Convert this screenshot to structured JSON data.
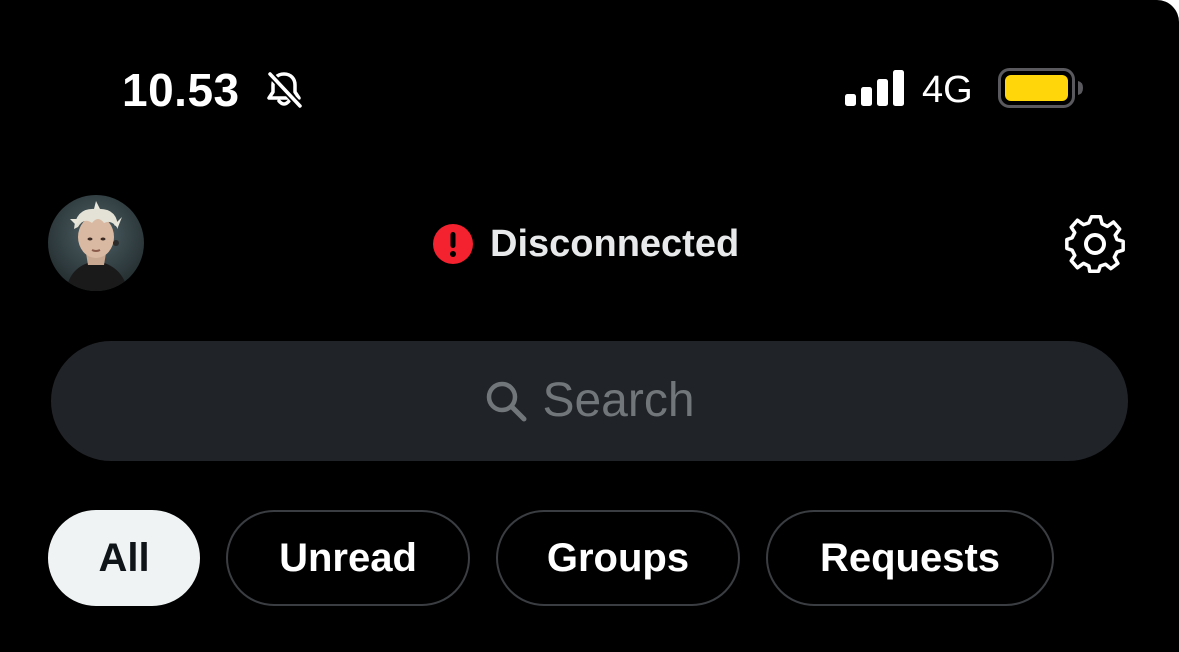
{
  "status_bar": {
    "time": "10.53",
    "silent_icon": "bell-slash-icon",
    "signal_icon": "cellular-signal-icon",
    "network": "4G",
    "battery_icon": "battery-icon",
    "battery_color": "#ffd60a"
  },
  "header": {
    "avatar": "profile-avatar",
    "connection_status": "Disconnected",
    "connection_icon": "alert-icon",
    "connection_color": "#f4212e",
    "settings_icon": "gear-icon"
  },
  "search": {
    "placeholder": "Search",
    "icon": "search-icon"
  },
  "filters": [
    {
      "label": "All",
      "active": true
    },
    {
      "label": "Unread",
      "active": false
    },
    {
      "label": "Groups",
      "active": false
    },
    {
      "label": "Requests",
      "active": false
    }
  ]
}
